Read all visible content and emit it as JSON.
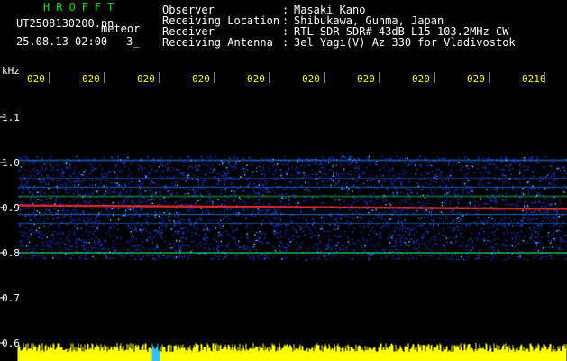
{
  "header": {
    "app_title": "HROFFT",
    "file_name": "UT2508130200.pn",
    "meteor_label": "meteor",
    "date_time": "25.08.13 02:00",
    "count": "3_"
  },
  "info": [
    {
      "label": "Observer",
      "colon": ":",
      "value": "Masaki Kano"
    },
    {
      "label": "Receiving Location",
      "colon": ":",
      "value": "Shibukawa, Gunma, Japan"
    },
    {
      "label": "Receiver",
      "colon": ":",
      "value": "RTL-SDR SDR# 43dB L15 103.2MHz CW"
    },
    {
      "label": "Receiving Antenna",
      "colon": ":",
      "value": "3el Yagi(V) Az 330 for Vladivostok"
    }
  ],
  "axis": {
    "unit": "kHz",
    "y_ticks": [
      "1.1",
      "1.0",
      "0.9",
      "0.8",
      "0.7",
      "0.6"
    ],
    "time_ticks": [
      "020",
      "020",
      "020",
      "020",
      "020",
      "020",
      "020",
      "020",
      "020",
      "0210"
    ]
  },
  "colors": {
    "text_white": "#ffffff",
    "text_yellow": "#ffff00",
    "title_green": "#00e000",
    "background": "#000000",
    "noise": "#1030c0",
    "band_hot": "#ff3030",
    "band_mid": "#30ff60",
    "trace_yellow": "#ffff00"
  }
}
